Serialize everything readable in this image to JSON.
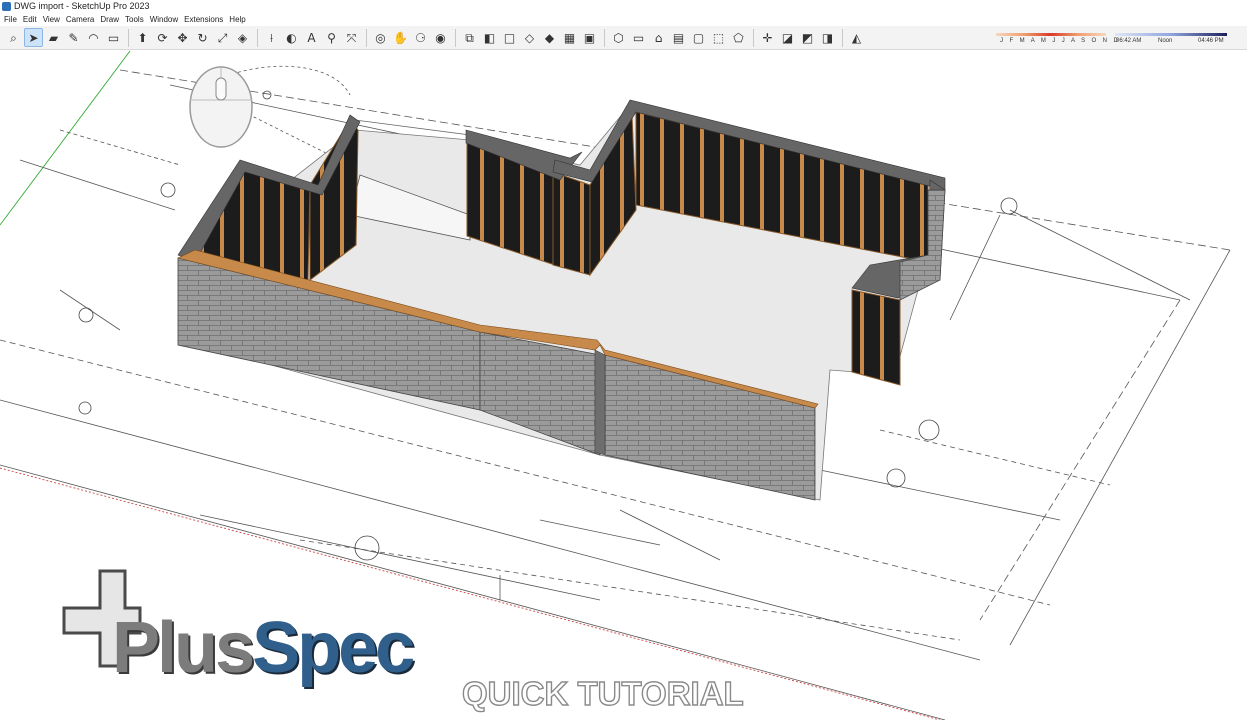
{
  "window": {
    "title": "DWG import - SketchUp Pro 2023"
  },
  "menu": {
    "items": [
      "File",
      "Edit",
      "View",
      "Camera",
      "Draw",
      "Tools",
      "Window",
      "Extensions",
      "Help"
    ]
  },
  "toolbar": {
    "groups": [
      [
        "search-icon",
        "select-arrow-icon",
        "eraser-icon",
        "pencil-icon",
        "arc-icon",
        "rectangle-icon"
      ],
      [
        "push-pull-icon",
        "follow-me-icon",
        "move-icon",
        "rotate-icon",
        "scale-icon",
        "offset-icon"
      ],
      [
        "tape-measure-icon",
        "paint-bucket-icon",
        "text-icon",
        "zoom-icon",
        "zoom-extents-icon"
      ],
      [
        "orbit-icon",
        "pan-icon",
        "walk-icon",
        "look-around-icon"
      ],
      [
        "section-plane-icon",
        "xray-icon",
        "wireframe-icon",
        "hidden-line-icon",
        "shaded-icon",
        "textured-icon",
        "monochrome-icon"
      ],
      [
        "iso-view-icon",
        "top-view-icon",
        "front-view-icon",
        "right-view-icon",
        "back-view-icon",
        "left-view-icon",
        "bottom-view-icon"
      ],
      [
        "axes-icon",
        "plusspec-icon-1",
        "plusspec-icon-2",
        "plusspec-icon-3"
      ],
      [
        "shadow-toggle-icon"
      ]
    ],
    "glyphs": [
      "⌕",
      "➤",
      "▰",
      "✎",
      "◠",
      "▭",
      "⬆",
      "⟳",
      "✥",
      "↻",
      "⤢",
      "◈",
      "⟊",
      "◐",
      "A",
      "⚲",
      "⤧",
      "◎",
      "✋",
      "⚆",
      "◉",
      "⧉",
      "◧",
      "□",
      "◇",
      "◆",
      "▦",
      "▣",
      "⬡",
      "▭",
      "⌂",
      "▤",
      "▢",
      "⬚",
      "⬠",
      "✛",
      "◪",
      "◩",
      "◨",
      "◭",
      "◐"
    ],
    "shadow_months": "J F M A M J J A S O N D",
    "shadow_time_start": "06:42 AM",
    "shadow_time_mid": "Noon",
    "shadow_time_end": "04:46 PM"
  },
  "overlay": {
    "logo_part1": "Plus",
    "logo_part2": "Spec",
    "caption": "QUICK TUTORIAL"
  },
  "colors": {
    "brick": "#9b9b9b",
    "brick_top": "#7a7a7a",
    "timber_frame": "#c88a4a",
    "insulation": "#1e1e1e",
    "floor": "#e6e6e6",
    "logo_blue": "#2f5f8a",
    "logo_gray": "#7c7c7c"
  }
}
